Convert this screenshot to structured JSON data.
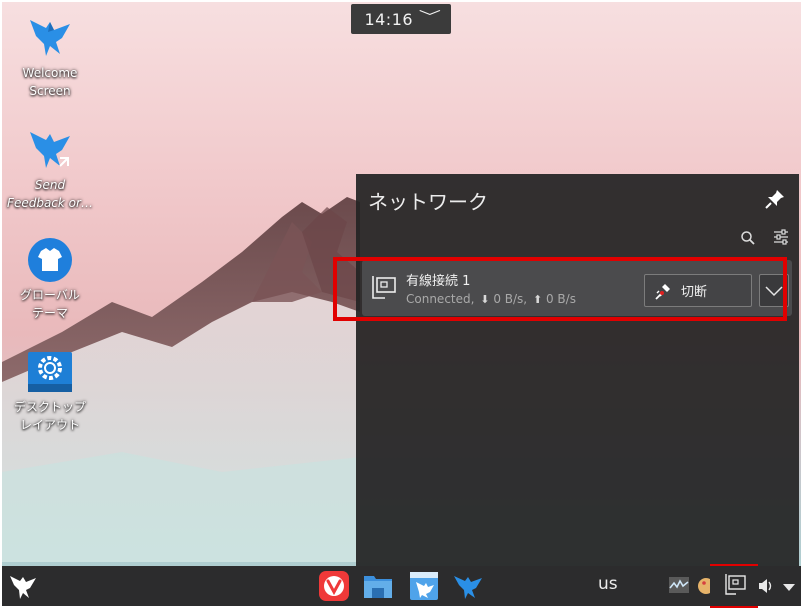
{
  "clock": {
    "time": "14:16",
    "toggle_glyph": "﹀"
  },
  "desktop_icons": [
    {
      "id": "welcome",
      "label": "Welcome\nScreen",
      "icon": "bird-icon"
    },
    {
      "id": "feedback",
      "label": "Send\nFeedback or…",
      "icon": "bird-link-icon"
    },
    {
      "id": "global-theme",
      "label": "グローバル\nテーマ",
      "icon": "tshirt-icon"
    },
    {
      "id": "desktop-layout",
      "label": "デスクトップ\nレイアウト",
      "icon": "layout-gear-icon"
    }
  ],
  "network_popup": {
    "title": "ネットワーク",
    "connection": {
      "name": "有線接続 1",
      "status_text": "Connected,",
      "download": "0 B/s,",
      "upload": "0 B/s",
      "disconnect_label": "切断"
    }
  },
  "taskbar": {
    "keyboard_layout": "us"
  },
  "colors": {
    "highlight": "#e10000",
    "popup_bg": "#232324",
    "taskbar_bg": "#2c2c2d",
    "accent_blue": "#2a8fe6"
  }
}
